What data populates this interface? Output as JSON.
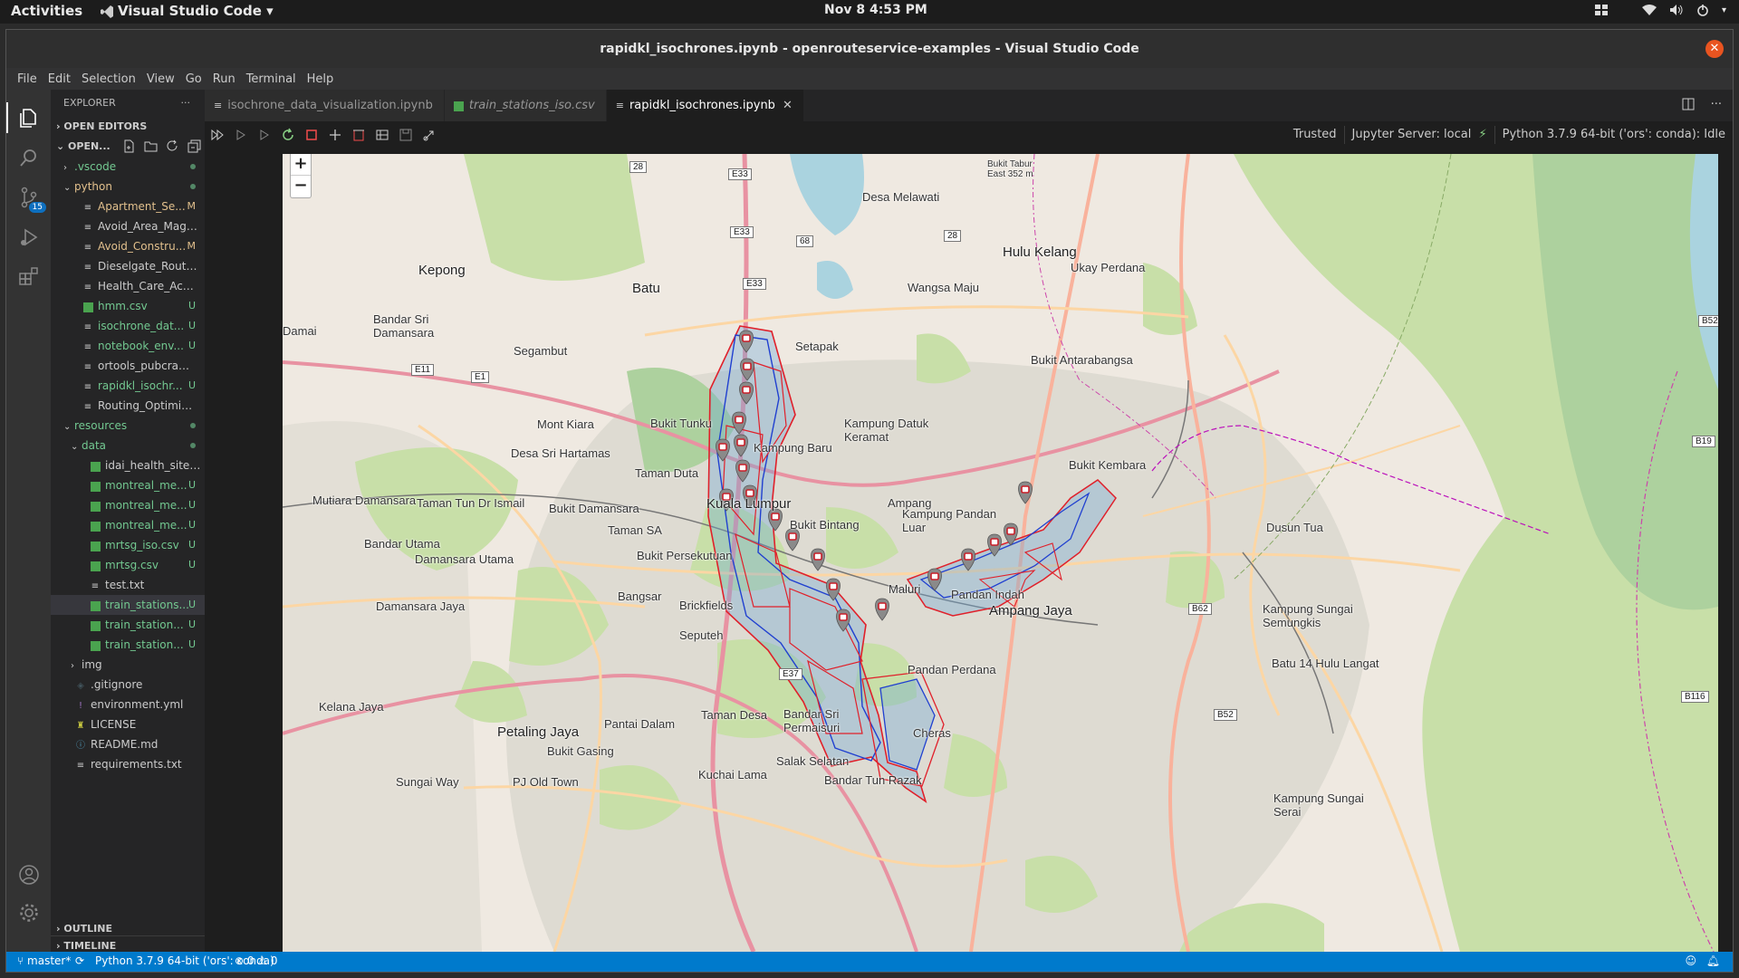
{
  "system": {
    "activities": "Activities",
    "app_name": "Visual Studio Code",
    "clock": "Nov 8  4:53 PM"
  },
  "window": {
    "title": "rapidkl_isochrones.ipynb - openrouteservice-examples - Visual Studio Code"
  },
  "menu": [
    "File",
    "Edit",
    "Selection",
    "View",
    "Go",
    "Run",
    "Terminal",
    "Help"
  ],
  "activitybar": {
    "scm_badge": "15"
  },
  "explorer": {
    "title": "EXPLORER",
    "more": "···",
    "open_editors": "OPEN EDITORS",
    "workspace": "OPEN...",
    "outline": "OUTLINE",
    "timeline": "TIMELINE",
    "items": [
      {
        "name": ".vscode",
        "type": "folder",
        "depth": 1,
        "open": false,
        "status": "dot",
        "color": "c-untr"
      },
      {
        "name": "python",
        "type": "folder",
        "depth": 1,
        "open": true,
        "status": "dot",
        "color": "c-mod"
      },
      {
        "name": "Apartment_Se...",
        "type": "nb",
        "depth": 2,
        "status": "M",
        "color": "c-mod"
      },
      {
        "name": "Avoid_Area_Magde...",
        "type": "nb",
        "depth": 2,
        "status": "",
        "color": "c-norm"
      },
      {
        "name": "Avoid_Constru...",
        "type": "nb",
        "depth": 2,
        "status": "M",
        "color": "c-mod"
      },
      {
        "name": "Dieselgate_Routing...",
        "type": "nb",
        "depth": 2,
        "status": "",
        "color": "c-norm"
      },
      {
        "name": "Health_Care_Access...",
        "type": "nb",
        "depth": 2,
        "status": "",
        "color": "c-norm"
      },
      {
        "name": "hmm.csv",
        "type": "csv",
        "depth": 2,
        "status": "U",
        "color": "c-untr"
      },
      {
        "name": "isochrone_dat...",
        "type": "nb",
        "depth": 2,
        "status": "U",
        "color": "c-untr"
      },
      {
        "name": "notebook_env...",
        "type": "nb",
        "depth": 2,
        "status": "U",
        "color": "c-untr"
      },
      {
        "name": "ortools_pubcrawl.ip...",
        "type": "nb",
        "depth": 2,
        "status": "",
        "color": "c-norm"
      },
      {
        "name": "rapidkl_isochr...",
        "type": "nb",
        "depth": 2,
        "status": "U",
        "color": "c-untr"
      },
      {
        "name": "Routing_Optimizati...",
        "type": "nb",
        "depth": 2,
        "status": "",
        "color": "c-norm"
      },
      {
        "name": "resources",
        "type": "folder",
        "depth": 1,
        "open": true,
        "status": "dot",
        "color": "c-untr"
      },
      {
        "name": "data",
        "type": "folder",
        "depth": 2,
        "open": true,
        "status": "dot",
        "color": "c-untr"
      },
      {
        "name": "idai_health_sites.c...",
        "type": "csv",
        "depth": 3,
        "status": "",
        "color": "c-norm"
      },
      {
        "name": "montreal_me...",
        "type": "csv",
        "depth": 3,
        "status": "U",
        "color": "c-untr"
      },
      {
        "name": "montreal_me...",
        "type": "csv",
        "depth": 3,
        "status": "U",
        "color": "c-untr"
      },
      {
        "name": "montreal_me...",
        "type": "csv",
        "depth": 3,
        "status": "U",
        "color": "c-untr"
      },
      {
        "name": "mrtsg_iso.csv",
        "type": "csv",
        "depth": 3,
        "status": "U",
        "color": "c-untr"
      },
      {
        "name": "mrtsg.csv",
        "type": "csv",
        "depth": 3,
        "status": "U",
        "color": "c-untr"
      },
      {
        "name": "test.txt",
        "type": "txt",
        "depth": 3,
        "status": "",
        "color": "c-norm"
      },
      {
        "name": "train_stations...",
        "type": "csv",
        "depth": 3,
        "status": "U",
        "color": "c-untr",
        "selected": true
      },
      {
        "name": "train_station...",
        "type": "csv",
        "depth": 3,
        "status": "U",
        "color": "c-untr"
      },
      {
        "name": "train_station...",
        "type": "csv",
        "depth": 3,
        "status": "U",
        "color": "c-untr"
      },
      {
        "name": "img",
        "type": "folder",
        "depth": 2,
        "open": false,
        "status": "",
        "color": "c-norm"
      },
      {
        "name": ".gitignore",
        "type": "git",
        "depth": 1,
        "status": "",
        "color": "c-norm"
      },
      {
        "name": "environment.yml",
        "type": "yml",
        "depth": 1,
        "status": "",
        "color": "c-norm"
      },
      {
        "name": "LICENSE",
        "type": "lic",
        "depth": 1,
        "status": "",
        "color": "c-norm"
      },
      {
        "name": "README.md",
        "type": "md",
        "depth": 1,
        "status": "",
        "color": "c-norm"
      },
      {
        "name": "requirements.txt",
        "type": "txt",
        "depth": 1,
        "status": "",
        "color": "c-norm"
      }
    ]
  },
  "tabs": [
    {
      "label": "isochrone_data_visualization.ipynb",
      "italic": false,
      "active": false
    },
    {
      "label": "train_stations_iso.csv",
      "italic": true,
      "active": false
    },
    {
      "label": "rapidkl_isochrones.ipynb",
      "italic": false,
      "active": true
    }
  ],
  "notebook": {
    "trusted": "Trusted",
    "server": "Jupyter Server: local",
    "kernel": "Python 3.7.9 64-bit ('ors': conda): Idle"
  },
  "map": {
    "zoom_in": "+",
    "zoom_out": "−",
    "colors": {
      "land": "#efe9e1",
      "park": "#c8dfa8",
      "urban": "#dedbd2",
      "water": "#aad3df",
      "iso_blue": "#2040d0",
      "iso_red": "#e0202a"
    },
    "labels": [
      {
        "t": "Kepong",
        "c": "big"
      },
      {
        "t": "Batu",
        "c": "big"
      },
      {
        "t": "Setapak",
        "c": ""
      },
      {
        "t": "Desa Melawati",
        "c": ""
      },
      {
        "t": "Wangsa Maju",
        "c": ""
      },
      {
        "t": "Hulu Kelang",
        "c": "big"
      },
      {
        "t": "Ukay Perdana",
        "c": ""
      },
      {
        "t": "Segambut",
        "c": ""
      },
      {
        "t": "Bandar Sri Damansara",
        "c": ""
      },
      {
        "t": "Mont Kiara",
        "c": ""
      },
      {
        "t": "Bukit Tunku",
        "c": ""
      },
      {
        "t": "Kampung Baru",
        "c": ""
      },
      {
        "t": "Kampung Datuk Keramat",
        "c": ""
      },
      {
        "t": "Bukit Antarabangsa",
        "c": ""
      },
      {
        "t": "Desa Sri Hartamas",
        "c": ""
      },
      {
        "t": "Taman Duta",
        "c": ""
      },
      {
        "t": "Mutiara Damansara",
        "c": ""
      },
      {
        "t": "Taman Tun Dr Ismail",
        "c": ""
      },
      {
        "t": "Bukit Damansara",
        "c": ""
      },
      {
        "t": "Kuala Lumpur",
        "c": "big"
      },
      {
        "t": "Bukit Bintang",
        "c": ""
      },
      {
        "t": "Ampang",
        "c": ""
      },
      {
        "t": "Kampung Pandan Luar",
        "c": ""
      },
      {
        "t": "Bandar Utama",
        "c": ""
      },
      {
        "t": "Taman SA",
        "c": ""
      },
      {
        "t": "Bukit Persekutuan",
        "c": ""
      },
      {
        "t": "Damansara Utama",
        "c": ""
      },
      {
        "t": "Bangsar",
        "c": ""
      },
      {
        "t": "Brickfields",
        "c": ""
      },
      {
        "t": "Maluri",
        "c": ""
      },
      {
        "t": "Pandan Indah",
        "c": ""
      },
      {
        "t": "Ampang Jaya",
        "c": "big"
      },
      {
        "t": "Dusun Tua",
        "c": ""
      },
      {
        "t": "Damansara Jaya",
        "c": ""
      },
      {
        "t": "Seputeh",
        "c": ""
      },
      {
        "t": "Pandan Perdana",
        "c": ""
      },
      {
        "t": "Kampung Sungai Semungkis",
        "c": ""
      },
      {
        "t": "Batu 14 Hulu Langat",
        "c": ""
      },
      {
        "t": "Kelana Jaya",
        "c": ""
      },
      {
        "t": "Petaling Jaya",
        "c": "big"
      },
      {
        "t": "Pantai Dalam",
        "c": ""
      },
      {
        "t": "Taman Desa",
        "c": ""
      },
      {
        "t": "Bandar Sri Permaisuri",
        "c": ""
      },
      {
        "t": "Cheras",
        "c": ""
      },
      {
        "t": "Bukit Gasing",
        "c": ""
      },
      {
        "t": "Salak Selatan",
        "c": ""
      },
      {
        "t": "Kuchai Lama",
        "c": ""
      },
      {
        "t": "Sungai Way",
        "c": ""
      },
      {
        "t": "PJ Old Town",
        "c": ""
      },
      {
        "t": "Bandar Tun Razak",
        "c": ""
      },
      {
        "t": "Kampung Sungai Serai",
        "c": ""
      },
      {
        "t": "Bukit Kembara",
        "c": ""
      },
      {
        "t": "Damai",
        "c": ""
      },
      {
        "t": "Bukit Tabur East 352 m",
        "c": ""
      }
    ],
    "shields": [
      "E33",
      "E33",
      "E11",
      "E1",
      "E37",
      "E33",
      "28",
      "68",
      "28",
      "B52",
      "B19",
      "B62",
      "B52",
      "B116"
    ],
    "stations": 20
  },
  "statusbar": {
    "branch": "master*",
    "interpreter": "Python 3.7.9 64-bit ('ors': conda)",
    "problems": "⊗ 0 ⚠ 0"
  }
}
